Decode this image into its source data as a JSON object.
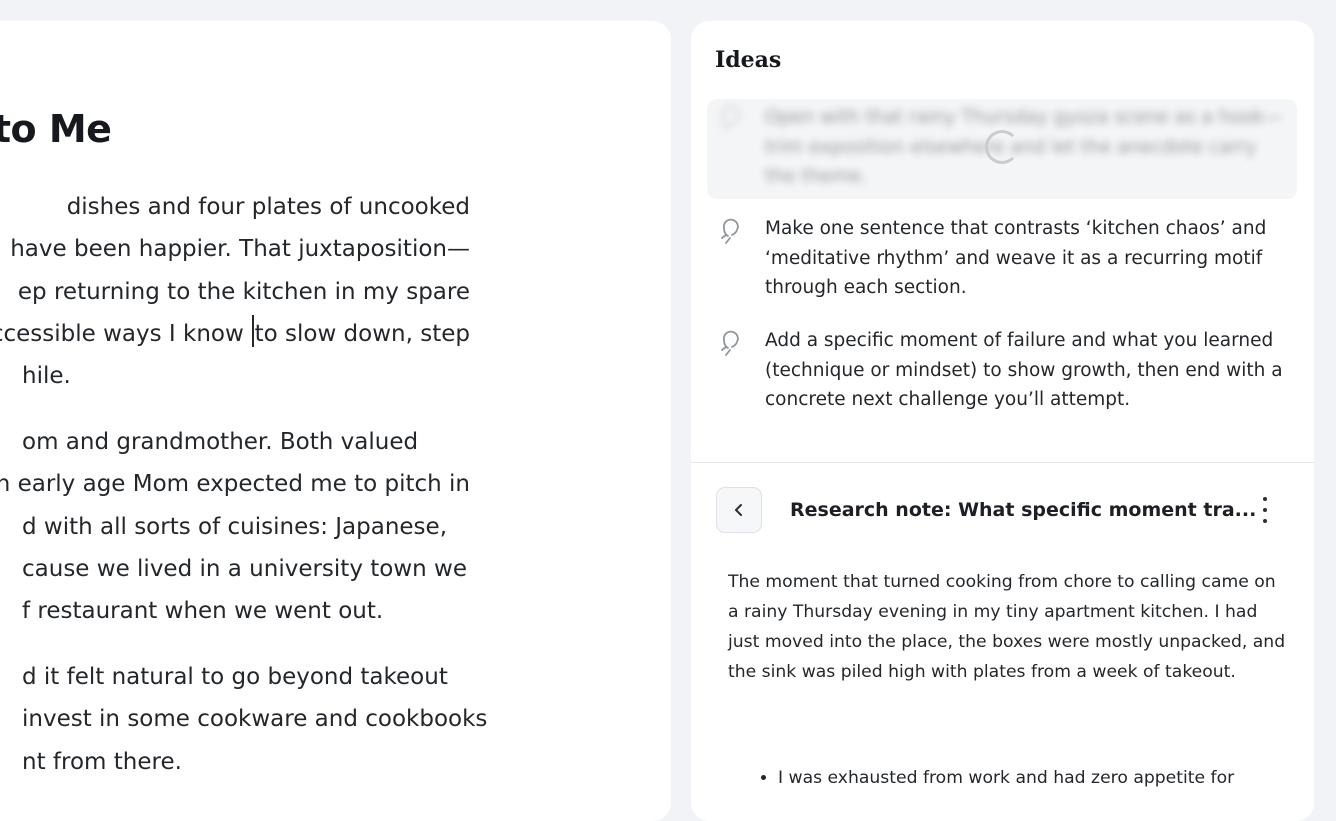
{
  "editor": {
    "title": "s to Me",
    "paragraphs": [
      {
        "lines": [
          "dishes and four plates of uncooked",
          "have been happier. That juxtaposition—",
          "ep returning to the kitchen in my spare",
          "ccessible ways I know",
          "to slow down, step",
          "hile."
        ]
      },
      {
        "lines": [
          "om and grandmother. Both valued",
          "n early age Mom expected me to pitch in",
          "d with all sorts of cuisines: Japanese,",
          "cause we lived in a university town we",
          "f restaurant when we went out."
        ]
      },
      {
        "lines": [
          "d it felt natural to go beyond takeout",
          "invest in some cookware and cookbooks",
          "nt from there."
        ]
      }
    ]
  },
  "sidebar": {
    "ideas_title": "Ideas",
    "ideas": [
      {
        "text": "Open with that rainy Thursday gyoza scene as a hook—trim exposition elsewhere and let the anecdote carry the theme.",
        "state": "loading"
      },
      {
        "text": "Make one sentence that contrasts ‘kitchen chaos’ and ‘meditative rhythm’ and weave it as a recurring motif through each section."
      },
      {
        "text": "Add a specific moment of failure and what you learned (technique or mindset) to show growth, then end with a concrete next challenge you’ll attempt."
      }
    ],
    "note": {
      "title": "Research note: What specific moment tra...",
      "body": "The moment that turned cooking from chore to calling came on a rainy Thursday evening in my tiny apartment kitchen. I had just moved into the place, the boxes were mostly unpacked, and the sink was piled high with plates from a week of takeout.",
      "bullets": [
        "I was exhausted from work and had zero appetite for"
      ]
    }
  }
}
